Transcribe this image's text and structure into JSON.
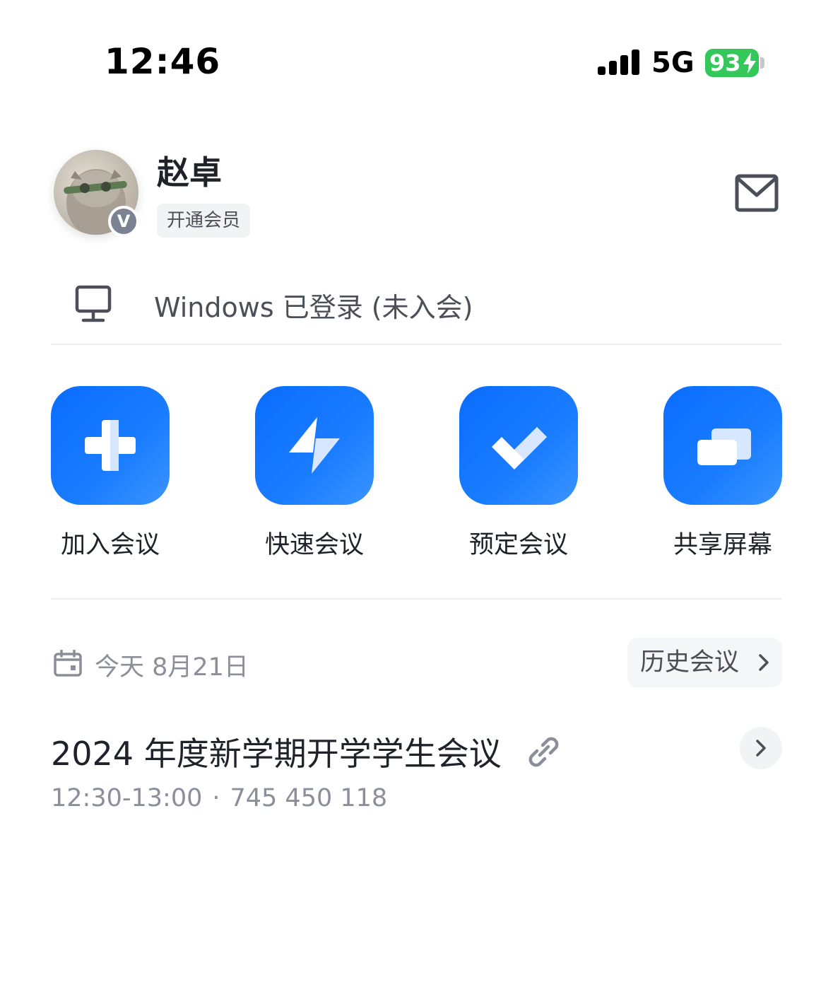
{
  "status_bar": {
    "time": "12:46",
    "network": "5G",
    "battery": "93",
    "battery_color": "#34c759"
  },
  "profile": {
    "name": "赵卓",
    "vip_badge": "V",
    "membership_label": "开通会员"
  },
  "device": {
    "status": "Windows 已登录 (未入会)",
    "icon": "monitor-icon"
  },
  "actions": [
    {
      "label": "加入会议",
      "icon": "plus-icon"
    },
    {
      "label": "快速会议",
      "icon": "lightning-icon"
    },
    {
      "label": "预定会议",
      "icon": "checkmark-icon"
    },
    {
      "label": "共享屏幕",
      "icon": "share-screen-icon"
    }
  ],
  "accent_color": "#0a6cff",
  "schedule": {
    "date_label": "今天 8月21日",
    "history_label": "历史会议"
  },
  "meetings": [
    {
      "title": "2024 年度新学期开学学生会议",
      "time": "12:30-13:00",
      "separator": "·",
      "meeting_id": "745 450 118"
    }
  ]
}
